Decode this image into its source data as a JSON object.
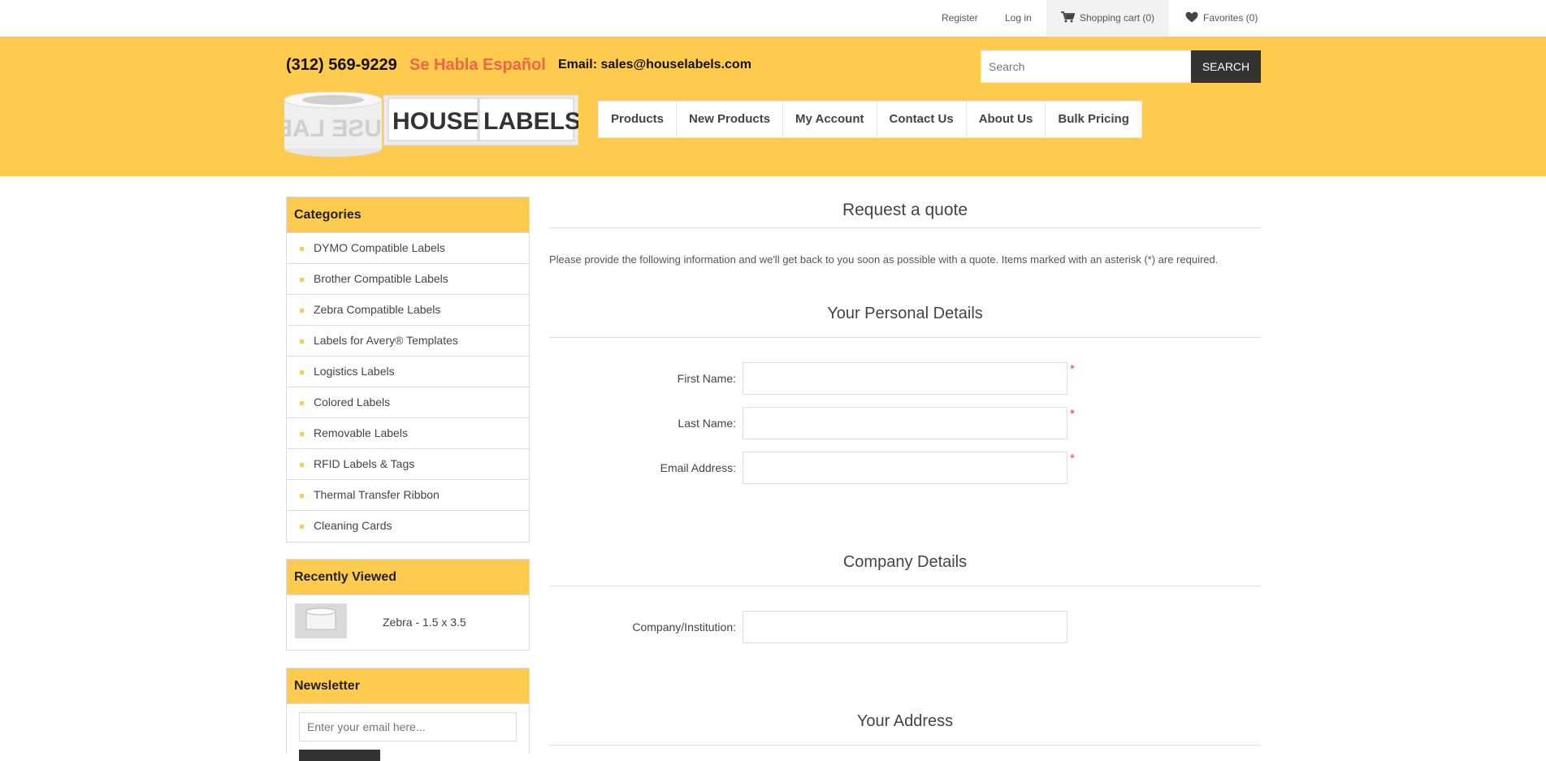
{
  "topbar": {
    "register": "Register",
    "login": "Log in",
    "cart": "Shopping cart (0)",
    "favorites": "Favorites (0)"
  },
  "header": {
    "phone": "(312) 569-9229",
    "habla": "Se Habla Español",
    "email": "Email: sales@houselabels.com",
    "search_placeholder": "Search",
    "search_button": "SEARCH",
    "logo_text_1": "HOUSE",
    "logo_text_2": "LABELS",
    "nav": [
      "Products",
      "New Products",
      "My Account",
      "Contact Us",
      "About Us",
      "Bulk Pricing"
    ]
  },
  "sidebar": {
    "categories_title": "Categories",
    "categories": [
      "DYMO Compatible Labels",
      "Brother Compatible Labels",
      "Zebra Compatible Labels",
      "Labels for Avery® Templates",
      "Logistics Labels",
      "Colored Labels",
      "Removable Labels",
      "RFID Labels & Tags",
      "Thermal Transfer Ribbon",
      "Cleaning Cards"
    ],
    "recently_viewed_title": "Recently Viewed",
    "recently_viewed_item": "Zebra - 1.5 x 3.5",
    "newsletter_title": "Newsletter",
    "newsletter_placeholder": "Enter your email here..."
  },
  "main": {
    "title": "Request a quote",
    "intro": "Please provide the following information and we'll get back to you soon as possible with a quote. Items marked with an asterisk (*) are required.",
    "personal_title": "Your Personal Details",
    "first_name": "First Name:",
    "last_name": "Last Name:",
    "email_address": "Email Address:",
    "required_mark": "*",
    "company_title": "Company Details",
    "company_label": "Company/Institution:",
    "address_title": "Your Address"
  },
  "colors": {
    "brand_yellow": "#fecb4f",
    "habla_red": "#f06545",
    "required_red": "#e4434b",
    "dark_button": "#333333"
  }
}
